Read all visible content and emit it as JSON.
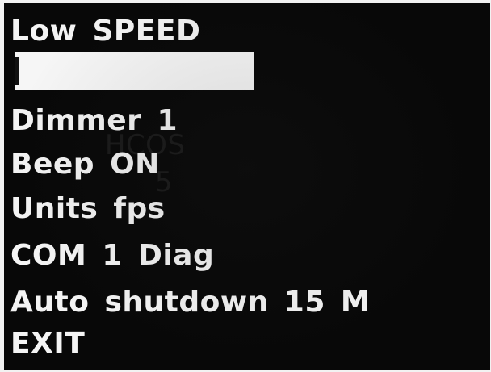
{
  "menu": {
    "items": [
      {
        "label": "Low SPEED"
      },
      {
        "label": "HCOS",
        "value": "5",
        "selected": true
      },
      {
        "label": "Dimmer 1"
      },
      {
        "label": "Beep ON"
      },
      {
        "label": "Units fps"
      },
      {
        "label": "COM 1 Diag"
      },
      {
        "label": "Auto shutdown 15 M"
      },
      {
        "label": "EXIT"
      }
    ]
  },
  "colors": {
    "background": "#080808",
    "text": "#f4f4f4",
    "highlight": "#f6f6f6",
    "highlight_text": "#1a1a1a"
  }
}
